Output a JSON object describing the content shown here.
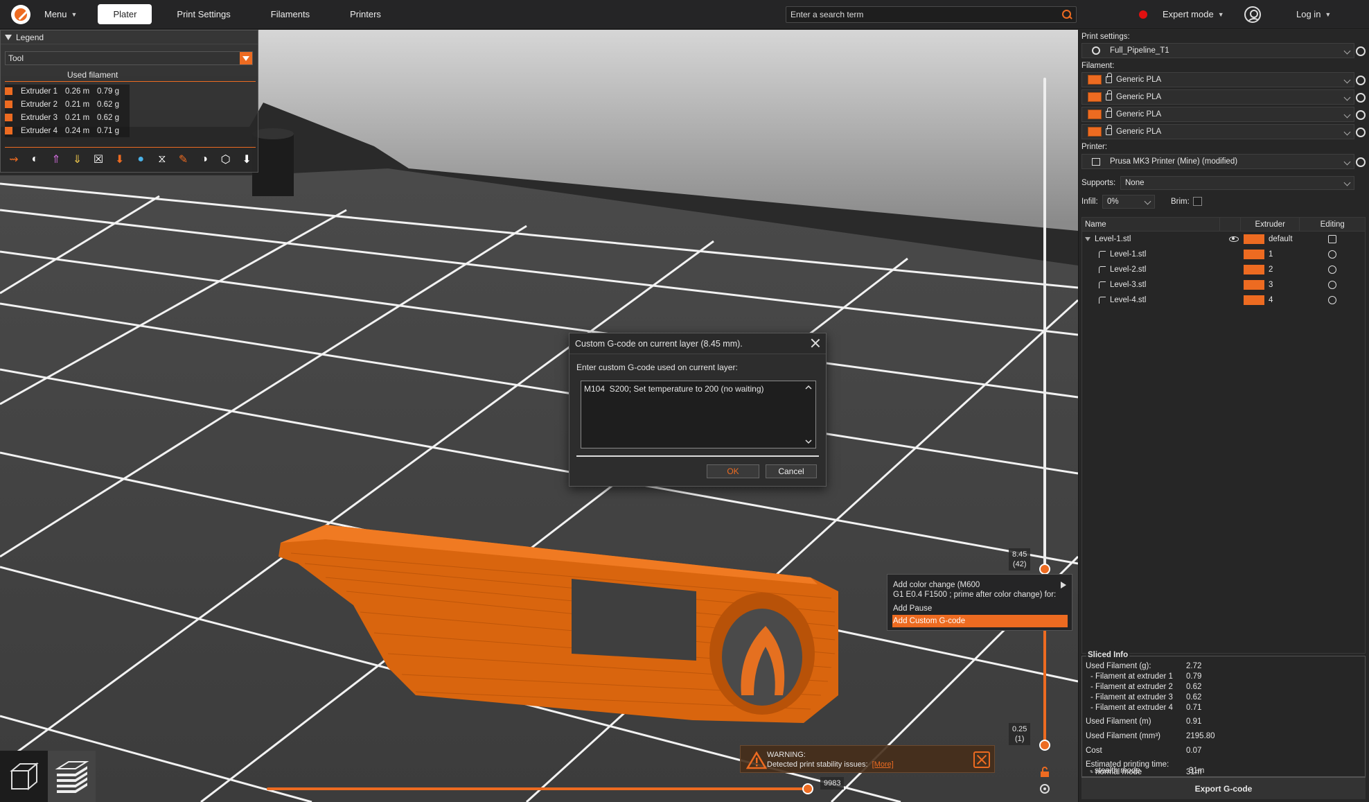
{
  "topbar": {
    "menu_label": "Menu",
    "tabs": [
      {
        "label": "Plater",
        "active": true
      },
      {
        "label": "Print Settings",
        "active": false
      },
      {
        "label": "Filaments",
        "active": false
      },
      {
        "label": "Printers",
        "active": false
      }
    ],
    "search_placeholder": "Enter a search term",
    "mode_label": "Expert mode",
    "mode_color": "#e01010",
    "login_label": "Log in"
  },
  "legend": {
    "title": "Legend",
    "view_type": "Tool",
    "subtitle": "Used filament",
    "rows": [
      {
        "name": "Extruder 1",
        "length": "0.26 m",
        "weight": "0.79 g"
      },
      {
        "name": "Extruder 2",
        "length": "0.21 m",
        "weight": "0.62 g"
      },
      {
        "name": "Extruder 3",
        "length": "0.21 m",
        "weight": "0.62 g"
      },
      {
        "name": "Extruder 4",
        "length": "0.24 m",
        "weight": "0.71 g"
      }
    ],
    "accent": "#ed6b21"
  },
  "vslider": {
    "top_label": "8.45",
    "top_layer": "(42)",
    "bottom_label": "0.25",
    "bottom_layer": "(1)"
  },
  "hslider": {
    "value_label": "9983"
  },
  "dialog": {
    "title": "Custom G-code on current layer (8.45 mm).",
    "prompt": "Enter custom G-code used on current layer:",
    "gcode": "M104  S200; Set temperature to 200 (no waiting)",
    "ok_label": "OK",
    "cancel_label": "Cancel"
  },
  "context_menu": {
    "items": [
      "Add color change (M600",
      "G1 E0.4 F1500 ; prime after color change) for:",
      "Add Pause",
      "Add Custom G-code"
    ]
  },
  "warning": {
    "title": "WARNING:",
    "message": "Detected print stability issues:",
    "link": "[More]"
  },
  "right_panel": {
    "print_settings_label": "Print settings:",
    "print_profile": "Full_Pipeline_T1",
    "filament_label": "Filament:",
    "filaments": [
      "Generic PLA",
      "Generic PLA",
      "Generic PLA",
      "Generic PLA"
    ],
    "printer_label": "Printer:",
    "printer_profile": "Prusa MK3 Printer (Mine) (modified)",
    "supports_label": "Supports:",
    "supports_value": "None",
    "infill_label": "Infill:",
    "infill_value": "0%",
    "brim_label": "Brim:",
    "table_headers": {
      "name": "Name",
      "extruder": "Extruder",
      "editing": "Editing"
    },
    "objects": [
      {
        "name": "Level-1.stl",
        "extruder": "default",
        "level": 0
      },
      {
        "name": "Level-1.stl",
        "extruder": "1",
        "level": 1
      },
      {
        "name": "Level-2.stl",
        "extruder": "2",
        "level": 1
      },
      {
        "name": "Level-3.stl",
        "extruder": "3",
        "level": 1
      },
      {
        "name": "Level-4.stl",
        "extruder": "4",
        "level": 1
      }
    ],
    "sliced_info": {
      "title": "Sliced Info",
      "rows": [
        {
          "label": "Used Filament (g):",
          "value": "2.72"
        },
        {
          "label": "   - Filament at extruder 1",
          "value": "0.79"
        },
        {
          "label": "   - Filament at extruder 2",
          "value": "0.62"
        },
        {
          "label": "   - Filament at extruder 3",
          "value": "0.62"
        },
        {
          "label": "   - Filament at extruder 4",
          "value": "0.71"
        },
        {
          "label": "Used Filament (m)",
          "value": "0.91"
        },
        {
          "label": "Used Filament (mm³)",
          "value": "2195.80"
        },
        {
          "label": "Cost",
          "value": "0.07"
        },
        {
          "label": "Estimated printing time:",
          "value": ""
        },
        {
          "label": "   - normal mode",
          "value": "31m"
        },
        {
          "label": "   - stealth mode",
          "value": "31m"
        }
      ]
    },
    "export_label": "Export G-code"
  }
}
